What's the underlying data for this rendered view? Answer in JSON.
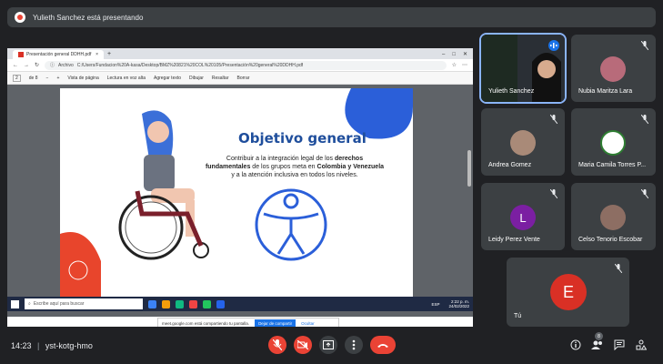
{
  "presenting_banner": {
    "text": "Yulieth Sanchez está presentando"
  },
  "browser": {
    "tab_title": "Presentación general DDHH.pdf",
    "tab_close": "×",
    "new_tab": "+",
    "url_prefix": "Archivo",
    "url": "C:/Users/Fundacion%20A-kasa/Desktop/BMZ%20821%20COL%20105/Presentación%20general%20DDHH.pdf",
    "page_num": "2",
    "page_of": "de 8",
    "zoom_minus": "−",
    "zoom_plus": "+",
    "tools": {
      "page_view": "Vista de página",
      "read_aloud": "Lectura en voz alta",
      "add_text": "Agregar texto",
      "draw": "Dibujar",
      "highlight": "Resaltar",
      "erase": "Borrar"
    }
  },
  "slide": {
    "title": "Objetivo general",
    "text_1": "Contribuir a la integración legal de los",
    "text_bold_1": "derechos fundamentales",
    "text_2": "de los grupos meta en",
    "text_bold_2": "Colombia y Venezuela",
    "text_3": "y a la atención inclusiva en todos los niveles."
  },
  "share_popup": {
    "message": "meet.google.com está compartiendo tu pantalla.",
    "stop": "Dejar de compartir",
    "hide": "Ocultar"
  },
  "taskbar": {
    "search_placeholder": "Escribe aquí para buscar",
    "lang": "ESP",
    "time": "2:22 p. m.",
    "date": "24/02/2022"
  },
  "participants": [
    {
      "name": "Yulieth Sanchez",
      "active": true
    },
    {
      "name": "Nubia Maritza Lara"
    },
    {
      "name": "Andrea Gomez"
    },
    {
      "name": "Maria Camila Torres P..."
    },
    {
      "name": "Leidy Perez Vente",
      "initial": "L",
      "color": "#7b1fa2"
    },
    {
      "name": "Celso Tenorio Escobar"
    },
    {
      "name": "Tú",
      "initial": "E",
      "color": "#d93025"
    }
  ],
  "bottom_bar": {
    "time": "14:23",
    "separator": "|",
    "meeting_code": "yst-kotg-hmo",
    "people_count": "8"
  },
  "colors": {
    "accent": "#1a73e8",
    "danger": "#ea4335",
    "tile": "#3c4043",
    "bg": "#202124"
  }
}
